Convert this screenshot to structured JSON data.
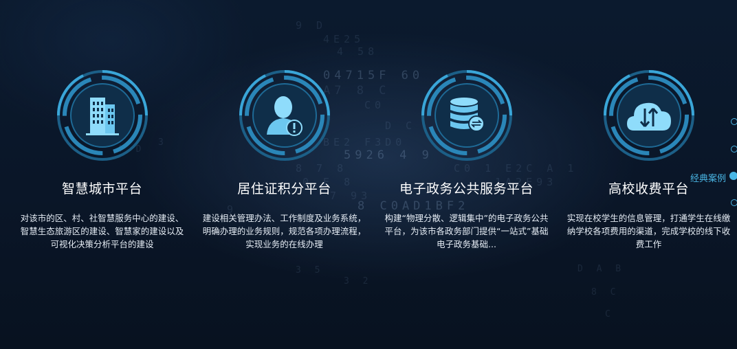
{
  "colors": {
    "accent": "#4ab7e6",
    "icon_fill": "#8fdcfb",
    "ring_dark": "#1c5f87",
    "background": "#0a1628"
  },
  "cards": [
    {
      "icon": "buildings-icon",
      "title": "智慧城市平台",
      "description": "对该市的区、村、社智慧服务中心的建设、智慧生态旅游区的建设、智慧家的建设以及可视化决策分析平台的建设"
    },
    {
      "icon": "user-alert-icon",
      "title": "居住证积分平台",
      "description": "建设相关管理办法、工作制度及业务系统，明确办理的业务规则，规范各项办理流程，实现业务的在线办理"
    },
    {
      "icon": "database-exchange-icon",
      "title": "电子政务公共服务平台",
      "description": "构建“物理分散、逻辑集中”的电子政务公共平台，为该市各政务部门提供“一站式”基础电子政务基础..."
    },
    {
      "icon": "cloud-transfer-icon",
      "title": "高校收费平台",
      "description": "实现在校学生的信息管理，打通学生在线缴纳学校各项费用的渠道，完成学校的线下收费工作"
    }
  ],
  "side_nav": {
    "active_label": "经典案例",
    "dots": 4,
    "active_index": 2
  }
}
